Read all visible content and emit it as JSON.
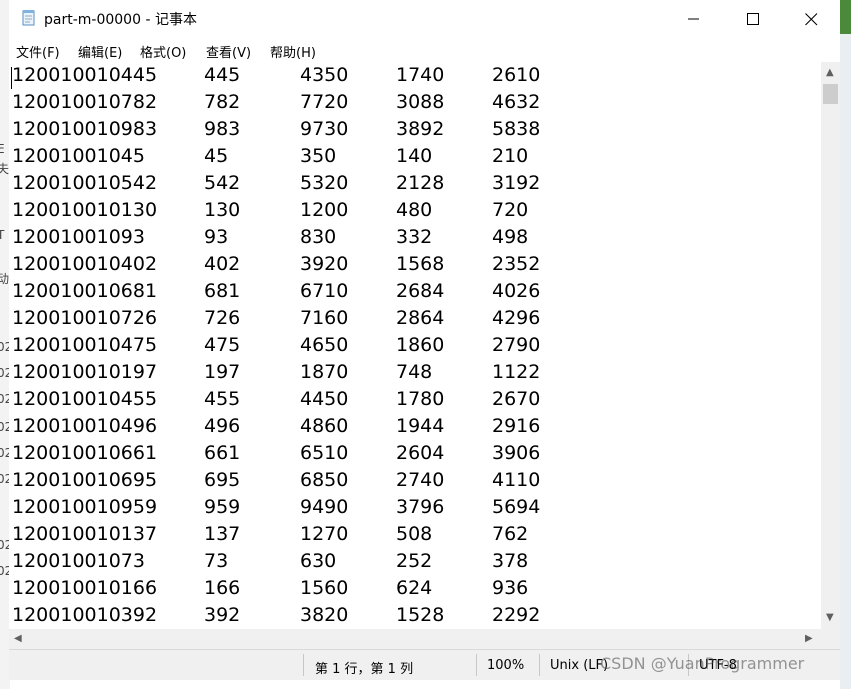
{
  "window": {
    "title": "part-m-00000 - 记事本",
    "icon": "notepad-icon"
  },
  "menu": [
    {
      "label": "文件(F)"
    },
    {
      "label": "编辑(E)"
    },
    {
      "label": "格式(O)"
    },
    {
      "label": "查看(V)"
    },
    {
      "label": "帮助(H)"
    }
  ],
  "rows": [
    [
      "120010010445",
      "445",
      "4350",
      "1740",
      "2610"
    ],
    [
      "120010010782",
      "782",
      "7720",
      "3088",
      "4632"
    ],
    [
      "120010010983",
      "983",
      "9730",
      "3892",
      "5838"
    ],
    [
      "12001001045",
      "45",
      "350",
      "140",
      "210"
    ],
    [
      "120010010542",
      "542",
      "5320",
      "2128",
      "3192"
    ],
    [
      "120010010130",
      "130",
      "1200",
      "480",
      "720"
    ],
    [
      "12001001093",
      "93",
      "830",
      "332",
      "498"
    ],
    [
      "120010010402",
      "402",
      "3920",
      "1568",
      "2352"
    ],
    [
      "120010010681",
      "681",
      "6710",
      "2684",
      "4026"
    ],
    [
      "120010010726",
      "726",
      "7160",
      "2864",
      "4296"
    ],
    [
      "120010010475",
      "475",
      "4650",
      "1860",
      "2790"
    ],
    [
      "120010010197",
      "197",
      "1870",
      "748",
      "1122"
    ],
    [
      "120010010455",
      "455",
      "4450",
      "1780",
      "2670"
    ],
    [
      "120010010496",
      "496",
      "4860",
      "1944",
      "2916"
    ],
    [
      "120010010661",
      "661",
      "6510",
      "2604",
      "3906"
    ],
    [
      "120010010695",
      "695",
      "6850",
      "2740",
      "4110"
    ],
    [
      "120010010959",
      "959",
      "9490",
      "3796",
      "5694"
    ],
    [
      "120010010137",
      "137",
      "1270",
      "508",
      "762"
    ],
    [
      "12001001073",
      "73",
      "630",
      "252",
      "378"
    ],
    [
      "120010010166",
      "166",
      "1560",
      "624",
      "936"
    ],
    [
      "120010010392",
      "392",
      "3820",
      "1528",
      "2292"
    ]
  ],
  "status": {
    "position": "第 1 行，第 1 列",
    "zoom": "100%",
    "line_ending": "Unix (LF)",
    "encoding": "UTF-8"
  },
  "watermark": "CSDN @YuanProgrammer",
  "colors": {
    "statusbar_bg": "#f0f0f0",
    "scrollbar_thumb": "#cdcdcd"
  }
}
